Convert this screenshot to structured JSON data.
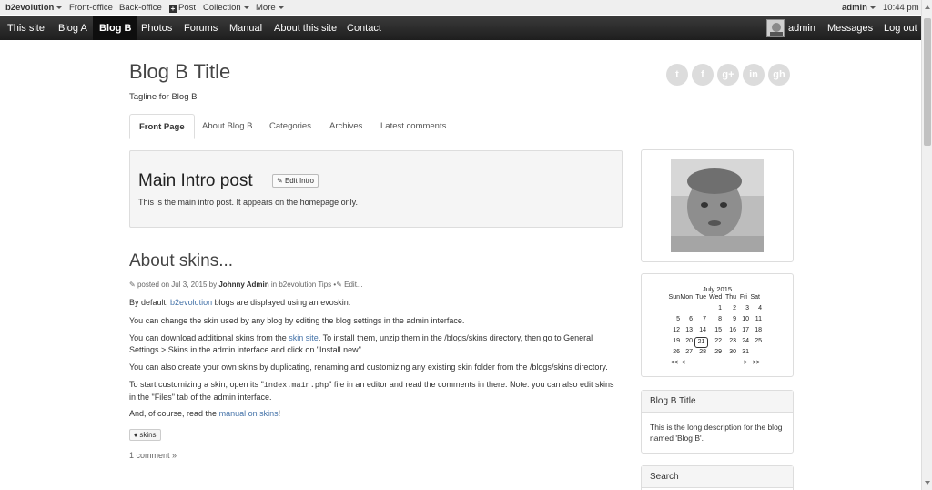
{
  "evobar": {
    "brand": "b2evolution",
    "front_office": "Front-office",
    "back_office": "Back-office",
    "post": "Post",
    "collection": "Collection",
    "more": "More",
    "user": "admin",
    "time": "10:44 pm"
  },
  "nav": {
    "items": [
      "This site",
      "Blog A",
      "Blog B",
      "Photos",
      "Forums",
      "Manual",
      "About this site",
      "Contact"
    ],
    "active_index": 2,
    "user": "admin",
    "messages": "Messages",
    "logout": "Log out"
  },
  "header": {
    "title": "Blog B Title",
    "tagline": "Tagline for Blog B",
    "social": [
      "t",
      "f",
      "g+",
      "in",
      "gh"
    ]
  },
  "tabs": [
    "Front Page",
    "About Blog B",
    "Categories",
    "Archives",
    "Latest comments"
  ],
  "intro": {
    "title": "Main Intro post",
    "edit_label": "Edit Intro",
    "text": "This is the main intro post. It appears on the homepage only."
  },
  "post": {
    "title": "About skins...",
    "meta_prefix": "posted on Jul 3, 2015 by",
    "author": "Johnny Admin",
    "meta_in": "in",
    "category": "b2evolution Tips",
    "edit": "Edit...",
    "p1_before": "By default,",
    "p1_link": "b2evolution",
    "p1_after": "blogs are displayed using an evoskin.",
    "p2": "You can change the skin used by any blog by editing the blog settings in the admin interface.",
    "p3_before": "You can download additional skins from the",
    "p3_link": "skin site",
    "p3_after": ". To install them, unzip them in the /blogs/skins directory, then go to General Settings > Skins in the admin interface and click on \"Install new\".",
    "p4": "You can also create your own skins by duplicating, renaming and customizing any existing skin folder from the /blogs/skins directory.",
    "p5_before": "To start customizing a skin, open its \"",
    "p5_code": "index.main.php",
    "p5_after": "\" file in an editor and read the comments in there. Note: you can also edit skins in the \"Files\" tab of the admin interface.",
    "p6_before": "And, of course, read the",
    "p6_link": "manual on skins",
    "p6_after": "!",
    "tag": "skins",
    "comments": "1 comment »"
  },
  "calendar": {
    "month": "July 2015",
    "weekdays": [
      "Sun",
      "Mon",
      "Tue",
      "Wed",
      "Thu",
      "Fri",
      "Sat"
    ],
    "weeks": [
      [
        "",
        "",
        "",
        "1",
        "2",
        "3",
        "4"
      ],
      [
        "5",
        "6",
        "7",
        "8",
        "9",
        "10",
        "11"
      ],
      [
        "12",
        "13",
        "14",
        "15",
        "16",
        "17",
        "18"
      ],
      [
        "19",
        "20",
        "21",
        "22",
        "23",
        "24",
        "25"
      ],
      [
        "26",
        "27",
        "28",
        "29",
        "30",
        "31",
        ""
      ]
    ],
    "today": "21",
    "prev_year": "<<",
    "prev_month": "<",
    "next_month": ">",
    "next_year": ">>"
  },
  "sidebar": {
    "about_title": "Blog B Title",
    "about_text": "This is the long description for the blog named 'Blog B'.",
    "search_title": "Search"
  },
  "colors": {
    "link": "#4472a8",
    "nav_bg": "#2b2b2b",
    "evobar_bg": "#efefef"
  }
}
